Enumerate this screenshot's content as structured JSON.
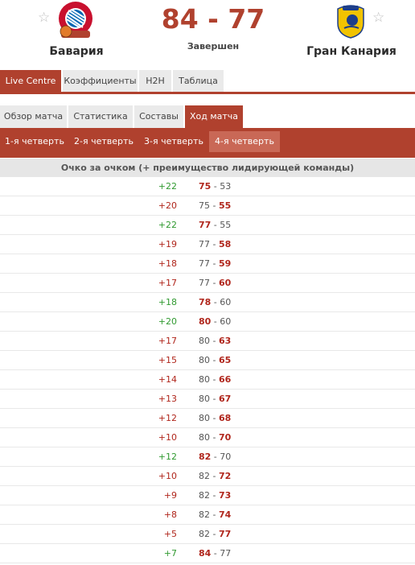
{
  "match": {
    "home": {
      "name": "Бавария",
      "logo_text": "FC BAYERN MÜNCHEN BASKETBALL"
    },
    "away": {
      "name": "Гран Канария",
      "logo_text": "CB GRAN CANARIA"
    },
    "score": "84 - 77",
    "status": "Завершен",
    "favorite_icon": "☆"
  },
  "tabs_main": [
    {
      "label": "Live Centre",
      "active": true
    },
    {
      "label": "Коэффициенты",
      "active": false
    },
    {
      "label": "H2H",
      "active": false
    },
    {
      "label": "Таблица",
      "active": false
    }
  ],
  "tabs_sub": [
    {
      "label": "Обзор матча",
      "active": false
    },
    {
      "label": "Статистика",
      "active": false
    },
    {
      "label": "Составы",
      "active": false
    },
    {
      "label": "Ход матча",
      "active": true
    }
  ],
  "quarters": [
    {
      "label": "1-я четверть",
      "active": false
    },
    {
      "label": "2-я четверть",
      "active": false
    },
    {
      "label": "3-я четверть",
      "active": false
    },
    {
      "label": "4-я четверть",
      "active": true
    }
  ],
  "table_header": "Очко за очком (+ преимущество лидирующей команды)",
  "colors": {
    "accent": "#b0412e",
    "home_lead": "#319a31",
    "away_lead": "#b0261c"
  },
  "points": [
    {
      "lead": "+22",
      "lead_side": "home",
      "home": "75",
      "sep": " - ",
      "away": "53",
      "scored": "home"
    },
    {
      "lead": "+20",
      "lead_side": "home",
      "home": "75",
      "sep": " - ",
      "away": "55",
      "scored": "away"
    },
    {
      "lead": "+22",
      "lead_side": "home",
      "home": "77",
      "sep": " - ",
      "away": "55",
      "scored": "home"
    },
    {
      "lead": "+19",
      "lead_side": "home",
      "home": "77",
      "sep": " - ",
      "away": "58",
      "scored": "away"
    },
    {
      "lead": "+18",
      "lead_side": "home",
      "home": "77",
      "sep": " - ",
      "away": "59",
      "scored": "away"
    },
    {
      "lead": "+17",
      "lead_side": "home",
      "home": "77",
      "sep": " - ",
      "away": "60",
      "scored": "away"
    },
    {
      "lead": "+18",
      "lead_side": "home",
      "home": "78",
      "sep": " - ",
      "away": "60",
      "scored": "home"
    },
    {
      "lead": "+20",
      "lead_side": "home",
      "home": "80",
      "sep": " - ",
      "away": "60",
      "scored": "home"
    },
    {
      "lead": "+17",
      "lead_side": "home",
      "home": "80",
      "sep": " - ",
      "away": "63",
      "scored": "away"
    },
    {
      "lead": "+15",
      "lead_side": "home",
      "home": "80",
      "sep": " - ",
      "away": "65",
      "scored": "away"
    },
    {
      "lead": "+14",
      "lead_side": "home",
      "home": "80",
      "sep": " - ",
      "away": "66",
      "scored": "away"
    },
    {
      "lead": "+13",
      "lead_side": "home",
      "home": "80",
      "sep": " - ",
      "away": "67",
      "scored": "away"
    },
    {
      "lead": "+12",
      "lead_side": "home",
      "home": "80",
      "sep": " - ",
      "away": "68",
      "scored": "away"
    },
    {
      "lead": "+10",
      "lead_side": "home",
      "home": "80",
      "sep": " - ",
      "away": "70",
      "scored": "away"
    },
    {
      "lead": "+12",
      "lead_side": "home",
      "home": "82",
      "sep": " - ",
      "away": "70",
      "scored": "home"
    },
    {
      "lead": "+10",
      "lead_side": "home",
      "home": "82",
      "sep": " - ",
      "away": "72",
      "scored": "away"
    },
    {
      "lead": "+9",
      "lead_side": "home",
      "home": "82",
      "sep": " - ",
      "away": "73",
      "scored": "away"
    },
    {
      "lead": "+8",
      "lead_side": "home",
      "home": "82",
      "sep": " - ",
      "away": "74",
      "scored": "away"
    },
    {
      "lead": "+5",
      "lead_side": "home",
      "home": "82",
      "sep": " - ",
      "away": "77",
      "scored": "away"
    },
    {
      "lead": "+7",
      "lead_side": "home",
      "home": "84",
      "sep": " - ",
      "away": "77",
      "scored": "home"
    }
  ]
}
